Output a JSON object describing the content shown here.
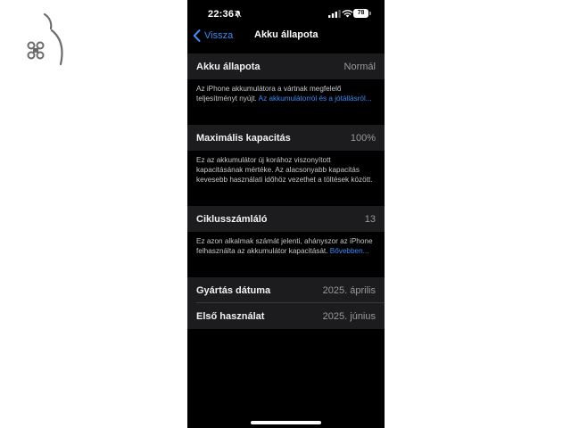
{
  "status_bar": {
    "time": "22:36",
    "battery_level": "78"
  },
  "nav": {
    "back_label": "Vissza",
    "title": "Akku állapota"
  },
  "sections": {
    "health": {
      "label": "Akku állapota",
      "value": "Normál",
      "footer_text": "Az iPhone akkumulátora a vártnak megfelelő teljesítményt nyújt.",
      "footer_link": "Az akkumulátorról és a jótállásról..."
    },
    "capacity": {
      "label": "Maximális kapacitás",
      "value": "100%",
      "footer_text": "Ez az akkumulátor új korához viszonyított kapacitásának mértéke. Az alacsonyabb kapacitás kevesebb használati időhöz vezethet a töltések között."
    },
    "cycles": {
      "label": "Ciklusszámláló",
      "value": "13",
      "footer_text": "Ez azon alkalmak számát jelenti, ahányszor az iPhone felhasználta az akkumulátor kapacitását.",
      "footer_link": "Bővebben..."
    },
    "manufacture": {
      "label": "Gyártás dátuma",
      "value": "2025. április"
    },
    "first_use": {
      "label": "Első használat",
      "value": "2025. június"
    }
  },
  "colors": {
    "accent": "#3a8bf7",
    "cell_background": "#1c1c1e",
    "screen_background": "#000000",
    "secondary_text": "#9a9a9e"
  },
  "icons": {
    "logo": "apple-keyboard-logo-icon",
    "back": "chevron-left-icon",
    "muted": "bell-slash-icon",
    "signal": "cellular-signal-icon",
    "wifi": "wifi-icon",
    "battery": "battery-icon"
  }
}
